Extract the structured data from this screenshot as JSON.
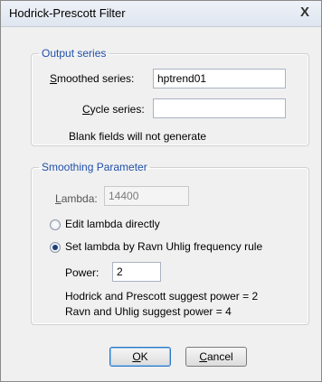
{
  "window": {
    "title": "Hodrick-Prescott Filter",
    "close_glyph": "X"
  },
  "output": {
    "legend": "Output series",
    "smoothed_label_key": "S",
    "smoothed_label_rest": "moothed series:",
    "smoothed_value": "hptrend01",
    "cycle_label_key": "C",
    "cycle_label_rest": "ycle series:",
    "cycle_value": "",
    "note": "Blank fields will not generate"
  },
  "smoothing": {
    "legend": "Smoothing Parameter",
    "lambda_label_key": "L",
    "lambda_label_rest": "ambda:",
    "lambda_value": "14400",
    "radio_edit_label": "Edit lambda directly",
    "radio_edit_checked": false,
    "radio_ru_label": "Set lambda by Ravn Uhlig frequency rule",
    "radio_ru_checked": true,
    "power_label": "Power:",
    "power_value": "2",
    "note1": "Hodrick and Prescott suggest power = 2",
    "note2": "Ravn and Uhlig suggest power = 4"
  },
  "buttons": {
    "ok_key": "O",
    "ok_rest": "K",
    "cancel_key": "C",
    "cancel_rest": "ancel"
  }
}
